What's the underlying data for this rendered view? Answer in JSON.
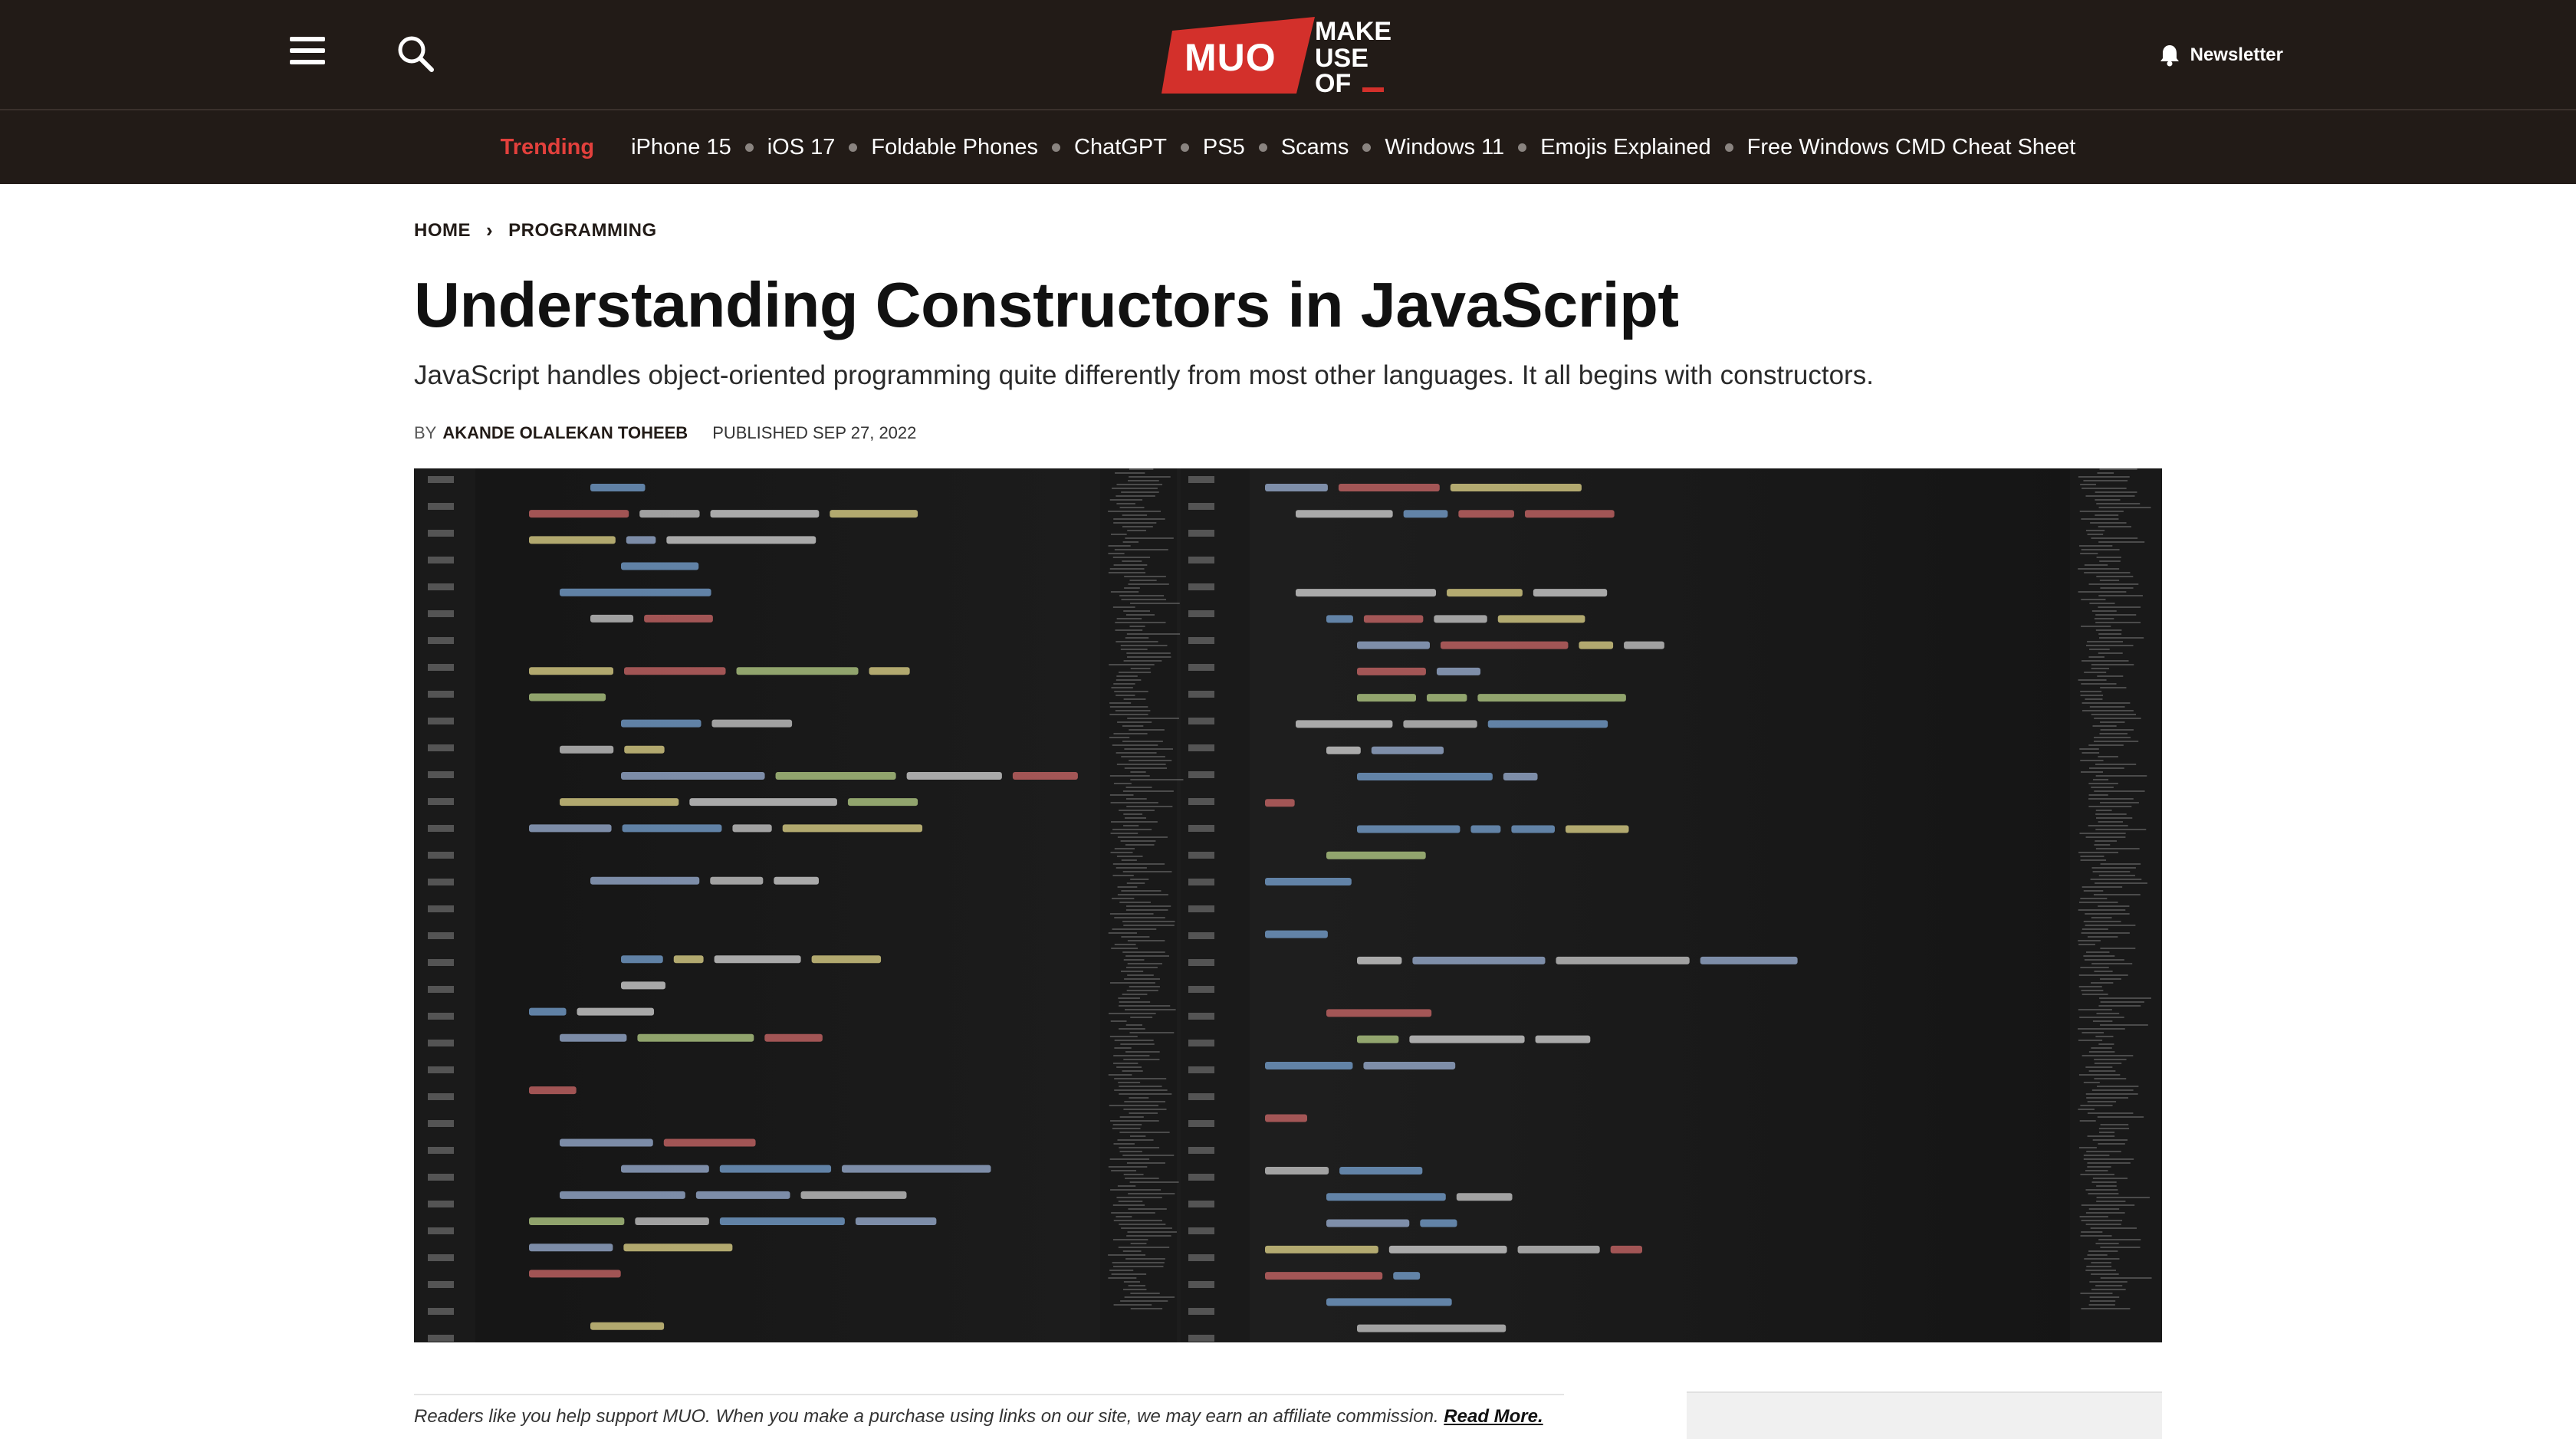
{
  "header": {
    "logo_text": "MUO",
    "logo_lines": [
      "MAKE",
      "USE",
      "OF"
    ],
    "newsletter_label": "Newsletter"
  },
  "trending": {
    "label": "Trending",
    "items": [
      "iPhone 15",
      "iOS 17",
      "Foldable Phones",
      "ChatGPT",
      "PS5",
      "Scams",
      "Windows 11",
      "Emojis Explained",
      "Free Windows CMD Cheat Sheet"
    ]
  },
  "breadcrumb": {
    "home": "HOME",
    "category": "PROGRAMMING"
  },
  "article": {
    "title": "Understanding Constructors in JavaScript",
    "subtitle": "JavaScript handles object-oriented programming quite differently from most other languages. It all begins with constructors.",
    "by": "BY",
    "author": "AKANDE OLALEKAN TOHEEB",
    "published": "PUBLISHED SEP 27, 2022"
  },
  "disclaimer": {
    "text": "Readers like you help support MUO. When you make a purchase using links on our site, we may earn an affiliate commission. ",
    "link": "Read More."
  },
  "colors": {
    "header_bg": "#221b17",
    "accent": "#e2403c"
  }
}
